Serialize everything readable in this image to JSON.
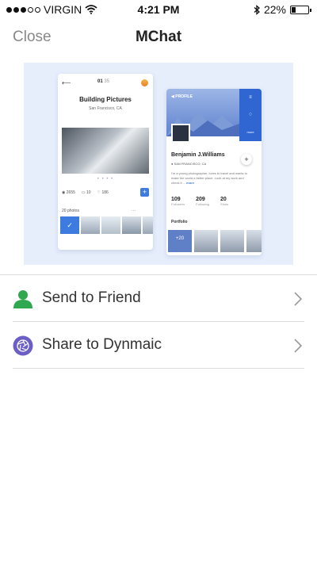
{
  "status_bar": {
    "carrier": "VIRGIN",
    "time": "4:21 PM",
    "battery": "22%",
    "battery_level": 0.22,
    "signal_bars_filled": 3,
    "signal_bars_total": 5
  },
  "nav": {
    "close_label": "Close",
    "title": "MChat"
  },
  "preview": {
    "background_color": "#e6eefc",
    "phone_left": {
      "page": "01",
      "page_total": "35",
      "title": "Building Pictures",
      "subtitle": "San Francisco, CA",
      "views": "2655",
      "comments": "10",
      "likes": "186",
      "photos_label": "20 photos",
      "more": "···"
    },
    "phone_right": {
      "header_label": "PROFILE",
      "name": "Benjamin J.Williams",
      "location": "SAN FRANCISCO, CA",
      "bio": "I'm a young photographer, loves to travel and wants to make the world a better place. Look at my work and check it ...",
      "bio_more": "more",
      "stats": [
        {
          "value": "109",
          "label": "Followers"
        },
        {
          "value": "209",
          "label": "Following"
        },
        {
          "value": "20",
          "label": "Shots"
        }
      ],
      "portfolio_label": "Portfolio",
      "portfolio_count": "+20",
      "side_label": "more"
    }
  },
  "actions": [
    {
      "label": "Send to Friend",
      "icon": "person-icon",
      "icon_color": "#2fa84f"
    },
    {
      "label": "Share to Dynmaic",
      "icon": "aperture-icon",
      "icon_color": "#6b5fc7"
    }
  ],
  "colors": {
    "accent_blue": "#3d7be0",
    "divider": "#dcdcdc",
    "chevron": "#999999"
  }
}
